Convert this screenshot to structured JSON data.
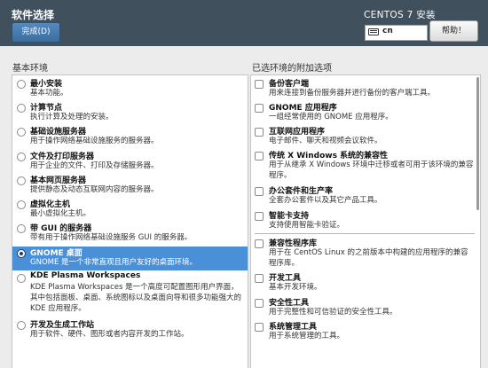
{
  "header": {
    "title": "软件选择",
    "done_label": "完成(D)",
    "os_name": "CENTOS 7 安装",
    "keyboard_layout": "cn",
    "help_label": "帮助！"
  },
  "left": {
    "title": "基本环境",
    "items": [
      {
        "name": "最小安装",
        "desc": "基本功能。"
      },
      {
        "name": "计算节点",
        "desc": "执行计算及处理的安装。"
      },
      {
        "name": "基础设施服务器",
        "desc": "用于操作网络基础设施服务的服务器。"
      },
      {
        "name": "文件及打印服务器",
        "desc": "用于企业的文件、打印及存储服务器。"
      },
      {
        "name": "基本网页服务器",
        "desc": "提供静态及动态互联网内容的服务器。"
      },
      {
        "name": "虚拟化主机",
        "desc": "最小虚拟化主机。"
      },
      {
        "name": "带 GUI 的服务器",
        "desc": "带有用于操作网络基础设施服务 GUI 的服务器。"
      },
      {
        "name": "GNOME 桌面",
        "desc": "GNOME 是一个非常直观且用户友好的桌面环境。",
        "selected": true
      },
      {
        "name": "KDE Plasma Workspaces",
        "desc": "KDE Plasma Workspaces 是一个高度可配置图形用户界面，其中包括面板、桌面、系统图标以及桌面向导和很多功能强大的 KDE 应用程序。"
      },
      {
        "name": "开发及生成工作站",
        "desc": "用于软件、硬件、图形或者内容开发的工作站。"
      }
    ]
  },
  "right": {
    "title": "已选环境的附加选项",
    "items": [
      {
        "name": "备份客户端",
        "desc": "用来连接到备份服务器并进行备份的客户端工具。"
      },
      {
        "name": "GNOME 应用程序",
        "desc": "一组经常使用的 GNOME 应用程序。"
      },
      {
        "name": "互联网应用程序",
        "desc": "电子邮件、聊天和视频会议软件。"
      },
      {
        "name": "传统 X Windows 系统的兼容性",
        "desc": "用于从继承 X Windows 环境中迁移或者可用于该环境的兼容程序。"
      },
      {
        "name": "办公套件和生产率",
        "desc": "全套办公套件以及其它产品工具。"
      },
      {
        "name": "智能卡支持",
        "desc": "支持使用智能卡验证。"
      },
      {
        "name": "兼容性程序库",
        "desc": "用于在 CentOS Linux 的之前版本中构建的应用程序的兼容程序库。"
      },
      {
        "name": "开发工具",
        "desc": "基本开发环境。"
      },
      {
        "name": "安全性工具",
        "desc": "用于完整性和可信验证的安全性工具。"
      },
      {
        "name": "系统管理工具",
        "desc": "用于系统管理的工具。"
      }
    ]
  }
}
